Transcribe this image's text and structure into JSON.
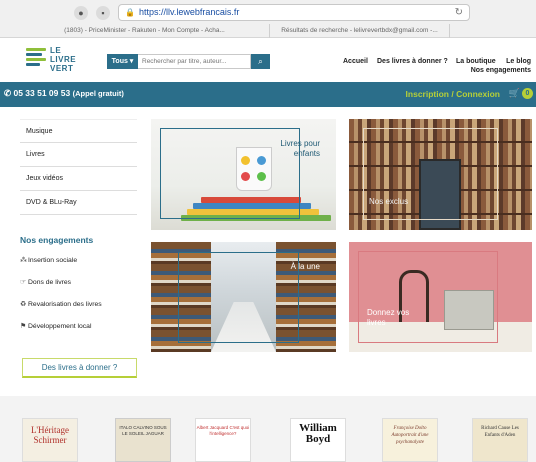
{
  "browser": {
    "url": "https://llv.lewebfrancais.fr",
    "tabs": [
      "(1803) - PriceMinister - Rakuten - Mon Compte - Acha...",
      "Résultats de recherche - lelivrevertbdx@gmail.com -..."
    ]
  },
  "header": {
    "logo_text": [
      "LE",
      "LIVRE",
      "VERT"
    ],
    "search": {
      "category": "Tous",
      "placeholder": "Rechercher par titre, auteur..."
    },
    "nav": {
      "accueil": "Accueil",
      "donner": "Des livres à donner ?",
      "boutique": "La boutique",
      "blog": "Le blog",
      "engagements": "Nos engagements"
    }
  },
  "topbar": {
    "phone": "05 33 51 09 53",
    "phone_note": "(Appel gratuit)",
    "login": "Inscription / Connexion",
    "cart_count": "0"
  },
  "sidebar": {
    "categories": [
      "Musique",
      "Livres",
      "Jeux vidéos",
      "DVD & BLu-Ray"
    ],
    "engagements_title": "Nos engagements",
    "engagements": [
      "Insertion sociale",
      "Dons de livres",
      "Revalorisation des livres",
      "Développement local"
    ],
    "give_button": "Des livres à donner ?"
  },
  "tiles": {
    "enfants": "Livres pour enfants",
    "exclus": "Nos exclus",
    "une": "À la une",
    "donnez": "Donnez vos livres"
  },
  "featured_books": [
    {
      "title": "L'Héritage Schirmer"
    },
    {
      "title": "ITALO CALVINO SOUS LE SOLEIL JAGUAR"
    },
    {
      "title": "Albert Jacquard C'est quoi l'intelligence?"
    },
    {
      "title": "William Boyd"
    },
    {
      "title": "Françoise Dolto Autoportrait d'une psychanalyste"
    },
    {
      "title": "Richard Cause Les Enfants d'Aden"
    }
  ],
  "colors": {
    "brand_blue": "#2b6e8a",
    "brand_green": "#b6cf38"
  }
}
